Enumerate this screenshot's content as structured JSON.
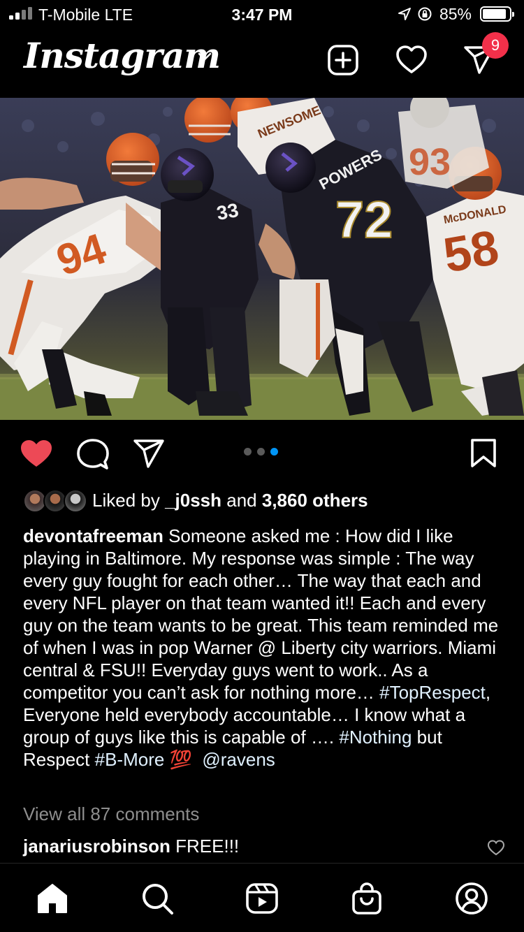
{
  "status_bar": {
    "carrier": "T-Mobile  LTE",
    "time": "3:47 PM",
    "battery": "85%"
  },
  "header": {
    "logo": "Instagram",
    "notification_count": "9"
  },
  "post": {
    "carousel": {
      "total": 3,
      "current": 3
    },
    "likes": {
      "prefix": "Liked by ",
      "user": "_j0ssh",
      "middle": " and ",
      "others": "3,860 others"
    },
    "caption": {
      "username": "devontafreeman",
      "part1": " Someone asked me : How did I like playing in Baltimore. My response was simple : The way every  guy fought for each other… The way that each and every NFL player on that team wanted it!! Each and every guy on the team wants to be great. This team reminded me of when I was in pop Warner @ Liberty city warriors. Miami central & FSU!! Everyday guys went to work.. As a competitor you can’t ask for nothing more… ",
      "tag1": "#TopRespect",
      "part2": ",  Everyone held everybody accountable… I know what a group of guys like this is capable of …. ",
      "tag2": "#Nothing",
      "part3": " but Respect ",
      "tag3": "#B-More",
      "emoji": "💯",
      "mention": "@ravens"
    },
    "view_all_comments": "View all 87 comments",
    "top_comment": {
      "username": "janariusrobinson",
      "text": " FREE!!!"
    }
  },
  "photo": {
    "jersey_names": [
      "NEWSOME",
      "POWERS",
      "McDONALD"
    ],
    "jersey_numbers": [
      "33",
      "72",
      "94",
      "58",
      "93"
    ]
  },
  "colors": {
    "background": "#000000",
    "like_red": "#ed4956",
    "badge_red": "#f2304a",
    "carousel_active": "#0095f6",
    "muted_text": "#8e8e8e"
  },
  "icons": {
    "header": [
      "new-post-icon",
      "activity-heart-icon",
      "direct-message-icon"
    ],
    "actions": [
      "like-heart-icon",
      "comment-icon",
      "share-icon",
      "save-bookmark-icon"
    ],
    "tabs": [
      "home-icon",
      "search-icon",
      "reels-icon",
      "shop-icon",
      "profile-icon"
    ]
  }
}
